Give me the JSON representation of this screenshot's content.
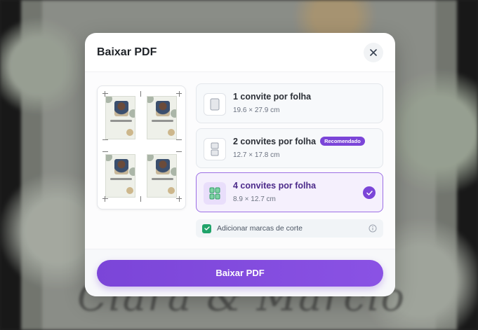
{
  "background": {
    "script_text": "Clara & Marcio"
  },
  "modal": {
    "title": "Baixar PDF",
    "close_icon": "close-icon",
    "options": [
      {
        "title": "1 convite por folha",
        "size": "19.6 × 27.9 cm",
        "selected": false
      },
      {
        "title": "2 convites por folha",
        "size": "12.7 × 17.8 cm",
        "badge": "Recomendado",
        "selected": false
      },
      {
        "title": "4 convites por folha",
        "size": "8.9 × 12.7 cm",
        "selected": true
      }
    ],
    "cut_marks": {
      "label": "Adicionar marcas de corte",
      "checked": true
    },
    "download_button": "Baixar PDF"
  },
  "colors": {
    "accent": "#7b45d8",
    "checkbox": "#20a36a"
  }
}
